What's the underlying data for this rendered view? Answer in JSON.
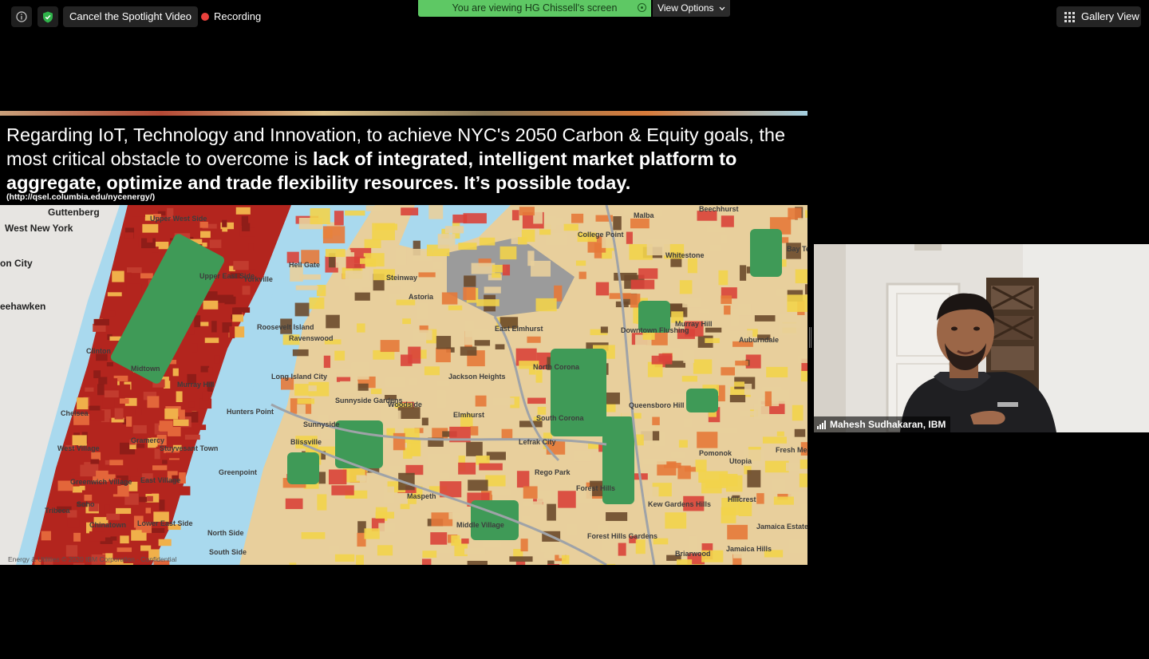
{
  "toolbar": {
    "info_icon": "info-icon",
    "security_icon": "shield-check-icon",
    "cancel_spotlight_label": "Cancel the Spotlight Video",
    "recording_label": "Recording",
    "gallery_view_label": "Gallery View"
  },
  "share_banner": {
    "viewing_label": "You are viewing HG Chissell's screen",
    "view_options_label": "View Options"
  },
  "slide": {
    "headline_plain": "Regarding IoT, Technology and Innovation, to achieve NYC's 2050 Carbon & Equity goals, the most critical obstacle to overcome is ",
    "headline_bold": "lack of integrated, intelligent market platform to aggregate, optimize and trade flexibility resources. It’s possible today.",
    "source": "(http://qsel.columbia.edu/nycenergy/)",
    "map_labels": [
      "Guttenberg",
      "West New York",
      "on City",
      "eehawken",
      "Upper West Side",
      "Upper East Side",
      "Yorkville",
      "Roosevelt Island",
      "Midtown",
      "Murray Hill",
      "Clinton",
      "Chelsea",
      "West Village",
      "Greenwich Village",
      "Soho",
      "Tribeca",
      "Chinatown",
      "Lower East Side",
      "East Village",
      "Stuyvesant Town",
      "Gramercy",
      "Hell Gate",
      "Steinway",
      "Astoria",
      "Ravenswood",
      "Long Island City",
      "Hunters Point",
      "Sunnyside",
      "Sunnyside Gardens",
      "Blissville",
      "Greenpoint",
      "North Side",
      "South Side",
      "Woodside",
      "Maspeth",
      "Middle Village",
      "Jackson Heights",
      "Elmhurst",
      "East Elmhurst",
      "North Corona",
      "South Corona",
      "Lefrak City",
      "Rego Park",
      "Forest Hills",
      "Forest Hills Gardens",
      "Kew Gardens Hills",
      "Downtown Flushing",
      "Queensboro Hill",
      "Murray Hill",
      "Auburndale",
      "College Point",
      "Malba",
      "Beechhurst",
      "Whitestone",
      "Bay Terrace",
      "Pomonok",
      "Utopia",
      "Fresh Meadows",
      "Hillcrest",
      "Jamaica Estates",
      "Jamaica Hills",
      "Briarwood"
    ],
    "footer": "Energy & Utilities © 2020 IBM Corporation · Confidential"
  },
  "video": {
    "participant_name": "Mahesh Sudhakaran, IBM",
    "signal_icon": "signal-bars-icon"
  },
  "colors": {
    "banner_green": "#5ec864",
    "recording_red": "#e9413c",
    "map_water": "#a9d9ee",
    "map_dark_red": "#b3251e",
    "map_orange": "#e5793a",
    "map_yellow": "#f2d34b",
    "map_tan": "#e8cf9c",
    "map_green": "#3f9a57",
    "map_brown": "#6b4a2c"
  }
}
